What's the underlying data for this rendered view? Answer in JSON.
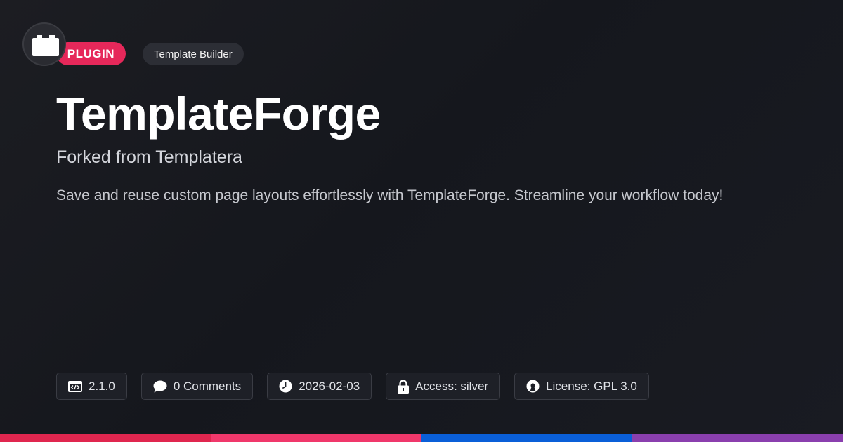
{
  "badge": {
    "type_label": "PLUGIN",
    "category_label": "Template Builder"
  },
  "title": "TemplateForge",
  "subtitle": "Forked from Templatera",
  "description": "Save and reuse custom page layouts effortlessly with TemplateForge. Streamline your workflow today!",
  "meta": [
    {
      "icon": "code-window-icon",
      "text": "2.1.0"
    },
    {
      "icon": "comment-icon",
      "text": "0 Comments"
    },
    {
      "icon": "clock-icon",
      "text": "2026-02-03"
    },
    {
      "icon": "lock-icon",
      "text": "Access: silver"
    },
    {
      "icon": "open-source-icon",
      "text": "License: GPL 3.0"
    }
  ],
  "colors": {
    "accent": "#e6285a",
    "stripe": [
      "#e0264f",
      "#f0386b",
      "#0a5fd8",
      "#8a3fae"
    ]
  }
}
